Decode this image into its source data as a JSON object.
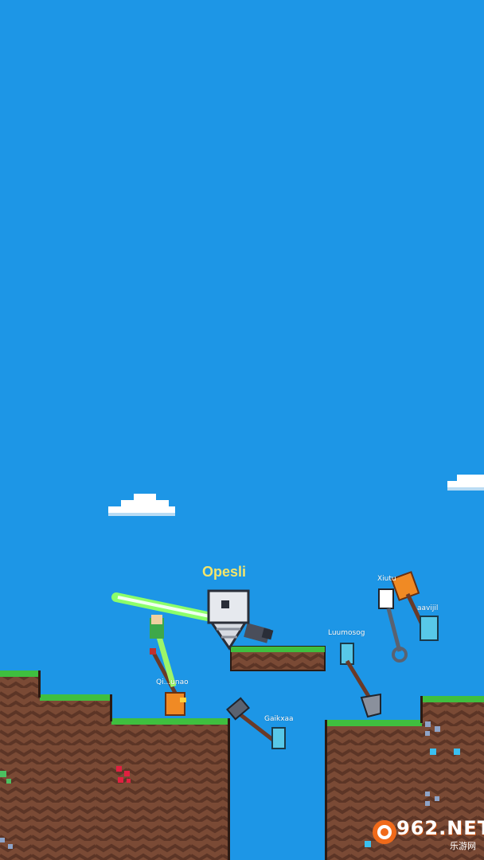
{
  "player": {
    "name": "Opesli",
    "color": "#f4e56b"
  },
  "opponents": [
    {
      "name": "Qi...unao"
    },
    {
      "name": "Gaikxaa"
    },
    {
      "name": "Luumosog"
    },
    {
      "name": "Xiutu"
    },
    {
      "name": "aavijil"
    }
  ],
  "watermark": {
    "main": "962.NET",
    "sub": "乐游网"
  },
  "colors": {
    "sky": "#1d96e6",
    "grass": "#3fbf3f",
    "dirt": "#7a4a35",
    "dirt_stripe": "#5c3526",
    "saber": "#8cff6a"
  }
}
